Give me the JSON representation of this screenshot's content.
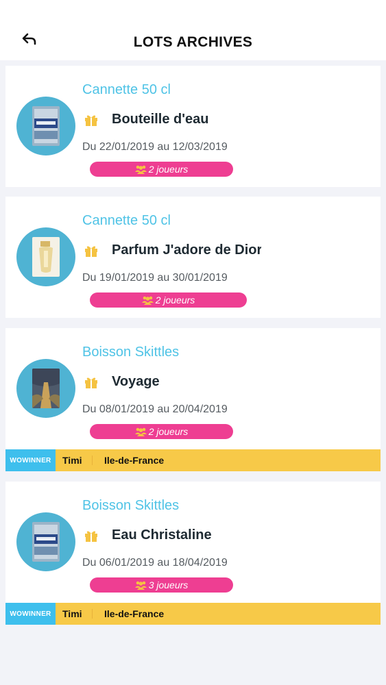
{
  "header": {
    "title": "LOTS ARCHIVES",
    "back_icon": "back-arrow-icon"
  },
  "colors": {
    "accent_blue": "#4fc3e6",
    "avatar_blue": "#4fb3d3",
    "players_pink": "#ee3e92",
    "winner_yellow": "#f7c948",
    "winner_tag_blue": "#3ebfed",
    "gift_yellow": "#f5c342"
  },
  "lots": [
    {
      "category": "Cannette 50 cl",
      "prize": "Bouteille d'eau",
      "dates": "Du 22/01/2019 au 12/03/2019",
      "players": "2 joueurs",
      "image": "water-bottle-image"
    },
    {
      "category": "Cannette 50 cl",
      "prize": "Parfum J'adore de Dior",
      "dates": "Du 19/01/2019 au 30/01/2019",
      "players": "2 joueurs",
      "image": "perfume-image"
    },
    {
      "category": "Boisson Skittles",
      "prize": "Voyage",
      "dates": "Du 08/01/2019 au 20/04/2019",
      "players": "2 joueurs",
      "image": "travel-image",
      "winner": {
        "tag": "WOWINNER",
        "name": "Timi",
        "region": "Ile-de-France"
      }
    },
    {
      "category": "Boisson Skittles",
      "prize": "Eau Christaline",
      "dates": "Du 06/01/2019 au 18/04/2019",
      "players": "3 joueurs",
      "image": "water-bottle-image",
      "winner": {
        "tag": "WOWINNER",
        "name": "Timi",
        "region": "Ile-de-France"
      }
    }
  ]
}
